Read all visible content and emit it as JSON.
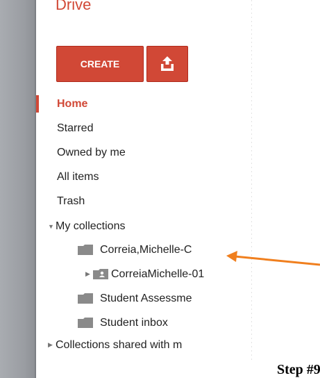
{
  "app": {
    "title": "Drive"
  },
  "toolbar": {
    "create_label": "CREATE"
  },
  "nav": {
    "items": [
      {
        "label": "Home",
        "active": true
      },
      {
        "label": "Starred"
      },
      {
        "label": "Owned by me"
      },
      {
        "label": "All items"
      },
      {
        "label": "Trash"
      }
    ]
  },
  "collections": {
    "my_label": "My collections",
    "items": [
      {
        "label": "Correia,Michelle-C",
        "shared": false,
        "expandable": false
      },
      {
        "label": "CorreiaMichelle-01",
        "shared": true,
        "expandable": true
      },
      {
        "label": "Student Assessme",
        "shared": false,
        "expandable": false
      },
      {
        "label": "Student inbox",
        "shared": false,
        "expandable": false
      }
    ],
    "shared_label": "Collections shared with m"
  },
  "annotation": {
    "step_text": "Step #9"
  },
  "colors": {
    "accent": "#d14836",
    "arrow": "#f07f1e",
    "folder": "#8a8a8a",
    "sidebar": "#9a9da2"
  }
}
